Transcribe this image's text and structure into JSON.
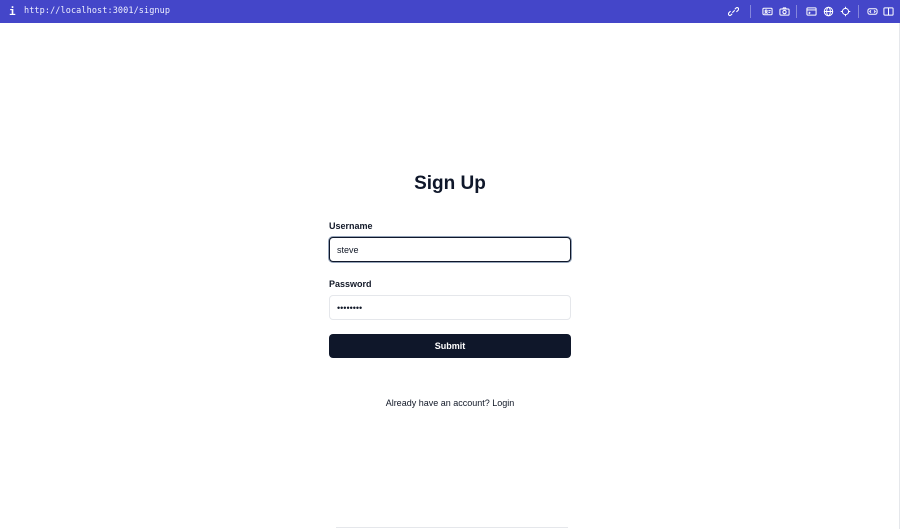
{
  "browser": {
    "url": "http://localhost:3001/signup",
    "info_icon": "i",
    "tools": [
      "link-icon",
      "id-card-icon",
      "camera-icon",
      "window-icon",
      "globe-icon",
      "crosshair-icon",
      "code-icon",
      "split-panel-icon"
    ]
  },
  "page": {
    "title": "Sign Up",
    "username": {
      "label": "Username",
      "value": "steve"
    },
    "password": {
      "label": "Password",
      "value": "••••••••"
    },
    "submit_label": "Submit",
    "login_prompt": "Already have an account?",
    "login_link": "Login"
  },
  "colors": {
    "topbar": "#4446c9",
    "button": "#0f172a",
    "text": "#111827"
  }
}
